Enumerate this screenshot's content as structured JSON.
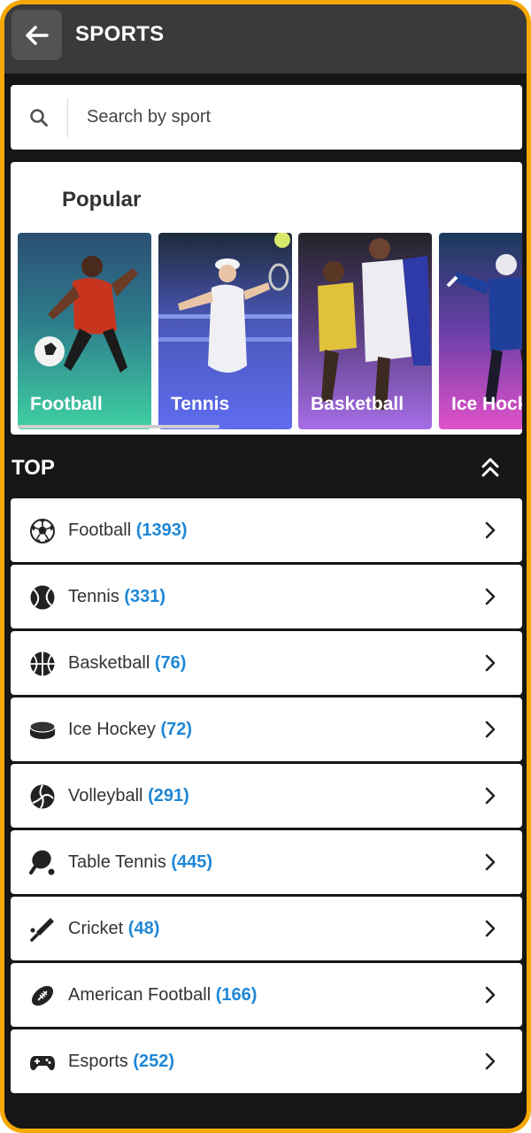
{
  "header": {
    "title": "SPORTS"
  },
  "search": {
    "placeholder": "Search by sport"
  },
  "popular": {
    "title": "Popular",
    "cards": [
      {
        "label": "Football"
      },
      {
        "label": "Tennis"
      },
      {
        "label": "Basketball"
      },
      {
        "label": "Ice Hockey"
      }
    ]
  },
  "top": {
    "title": "TOP",
    "items": [
      {
        "name": "Football",
        "count": "(1393)",
        "icon": "football-icon"
      },
      {
        "name": "Tennis",
        "count": "(331)",
        "icon": "tennis-icon"
      },
      {
        "name": "Basketball",
        "count": "(76)",
        "icon": "basketball-icon"
      },
      {
        "name": "Ice Hockey",
        "count": "(72)",
        "icon": "ice-hockey-puck-icon"
      },
      {
        "name": "Volleyball",
        "count": "(291)",
        "icon": "volleyball-icon"
      },
      {
        "name": "Table Tennis",
        "count": "(445)",
        "icon": "table-tennis-icon"
      },
      {
        "name": "Cricket",
        "count": "(48)",
        "icon": "cricket-icon"
      },
      {
        "name": "American Football",
        "count": "(166)",
        "icon": "american-football-icon"
      },
      {
        "name": "Esports",
        "count": "(252)",
        "icon": "gamepad-icon"
      }
    ]
  },
  "colors": {
    "frame": "#f5a800",
    "count": "#1f87d6",
    "background": "#161616",
    "header": "#3a3a3a"
  }
}
